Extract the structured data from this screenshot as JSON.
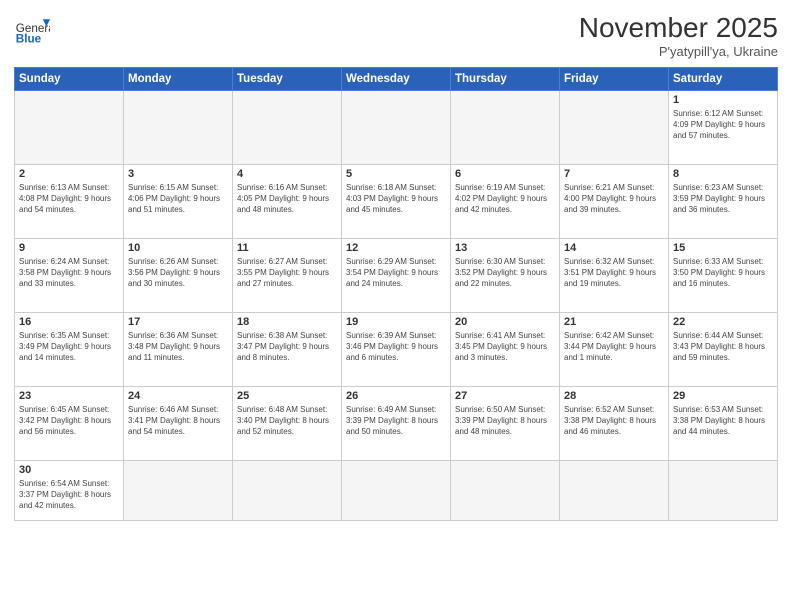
{
  "logo": {
    "text_general": "General",
    "text_blue": "Blue"
  },
  "title": "November 2025",
  "subtitle": "P'yatypill'ya, Ukraine",
  "days_of_week": [
    "Sunday",
    "Monday",
    "Tuesday",
    "Wednesday",
    "Thursday",
    "Friday",
    "Saturday"
  ],
  "weeks": [
    [
      {
        "day": "",
        "info": ""
      },
      {
        "day": "",
        "info": ""
      },
      {
        "day": "",
        "info": ""
      },
      {
        "day": "",
        "info": ""
      },
      {
        "day": "",
        "info": ""
      },
      {
        "day": "",
        "info": ""
      },
      {
        "day": "1",
        "info": "Sunrise: 6:12 AM\nSunset: 4:09 PM\nDaylight: 9 hours\nand 57 minutes."
      }
    ],
    [
      {
        "day": "2",
        "info": "Sunrise: 6:13 AM\nSunset: 4:08 PM\nDaylight: 9 hours\nand 54 minutes."
      },
      {
        "day": "3",
        "info": "Sunrise: 6:15 AM\nSunset: 4:06 PM\nDaylight: 9 hours\nand 51 minutes."
      },
      {
        "day": "4",
        "info": "Sunrise: 6:16 AM\nSunset: 4:05 PM\nDaylight: 9 hours\nand 48 minutes."
      },
      {
        "day": "5",
        "info": "Sunrise: 6:18 AM\nSunset: 4:03 PM\nDaylight: 9 hours\nand 45 minutes."
      },
      {
        "day": "6",
        "info": "Sunrise: 6:19 AM\nSunset: 4:02 PM\nDaylight: 9 hours\nand 42 minutes."
      },
      {
        "day": "7",
        "info": "Sunrise: 6:21 AM\nSunset: 4:00 PM\nDaylight: 9 hours\nand 39 minutes."
      },
      {
        "day": "8",
        "info": "Sunrise: 6:23 AM\nSunset: 3:59 PM\nDaylight: 9 hours\nand 36 minutes."
      }
    ],
    [
      {
        "day": "9",
        "info": "Sunrise: 6:24 AM\nSunset: 3:58 PM\nDaylight: 9 hours\nand 33 minutes."
      },
      {
        "day": "10",
        "info": "Sunrise: 6:26 AM\nSunset: 3:56 PM\nDaylight: 9 hours\nand 30 minutes."
      },
      {
        "day": "11",
        "info": "Sunrise: 6:27 AM\nSunset: 3:55 PM\nDaylight: 9 hours\nand 27 minutes."
      },
      {
        "day": "12",
        "info": "Sunrise: 6:29 AM\nSunset: 3:54 PM\nDaylight: 9 hours\nand 24 minutes."
      },
      {
        "day": "13",
        "info": "Sunrise: 6:30 AM\nSunset: 3:52 PM\nDaylight: 9 hours\nand 22 minutes."
      },
      {
        "day": "14",
        "info": "Sunrise: 6:32 AM\nSunset: 3:51 PM\nDaylight: 9 hours\nand 19 minutes."
      },
      {
        "day": "15",
        "info": "Sunrise: 6:33 AM\nSunset: 3:50 PM\nDaylight: 9 hours\nand 16 minutes."
      }
    ],
    [
      {
        "day": "16",
        "info": "Sunrise: 6:35 AM\nSunset: 3:49 PM\nDaylight: 9 hours\nand 14 minutes."
      },
      {
        "day": "17",
        "info": "Sunrise: 6:36 AM\nSunset: 3:48 PM\nDaylight: 9 hours\nand 11 minutes."
      },
      {
        "day": "18",
        "info": "Sunrise: 6:38 AM\nSunset: 3:47 PM\nDaylight: 9 hours\nand 8 minutes."
      },
      {
        "day": "19",
        "info": "Sunrise: 6:39 AM\nSunset: 3:46 PM\nDaylight: 9 hours\nand 6 minutes."
      },
      {
        "day": "20",
        "info": "Sunrise: 6:41 AM\nSunset: 3:45 PM\nDaylight: 9 hours\nand 3 minutes."
      },
      {
        "day": "21",
        "info": "Sunrise: 6:42 AM\nSunset: 3:44 PM\nDaylight: 9 hours\nand 1 minute."
      },
      {
        "day": "22",
        "info": "Sunrise: 6:44 AM\nSunset: 3:43 PM\nDaylight: 8 hours\nand 59 minutes."
      }
    ],
    [
      {
        "day": "23",
        "info": "Sunrise: 6:45 AM\nSunset: 3:42 PM\nDaylight: 8 hours\nand 56 minutes."
      },
      {
        "day": "24",
        "info": "Sunrise: 6:46 AM\nSunset: 3:41 PM\nDaylight: 8 hours\nand 54 minutes."
      },
      {
        "day": "25",
        "info": "Sunrise: 6:48 AM\nSunset: 3:40 PM\nDaylight: 8 hours\nand 52 minutes."
      },
      {
        "day": "26",
        "info": "Sunrise: 6:49 AM\nSunset: 3:39 PM\nDaylight: 8 hours\nand 50 minutes."
      },
      {
        "day": "27",
        "info": "Sunrise: 6:50 AM\nSunset: 3:39 PM\nDaylight: 8 hours\nand 48 minutes."
      },
      {
        "day": "28",
        "info": "Sunrise: 6:52 AM\nSunset: 3:38 PM\nDaylight: 8 hours\nand 46 minutes."
      },
      {
        "day": "29",
        "info": "Sunrise: 6:53 AM\nSunset: 3:38 PM\nDaylight: 8 hours\nand 44 minutes."
      }
    ],
    [
      {
        "day": "30",
        "info": "Sunrise: 6:54 AM\nSunset: 3:37 PM\nDaylight: 8 hours\nand 42 minutes."
      },
      {
        "day": "",
        "info": ""
      },
      {
        "day": "",
        "info": ""
      },
      {
        "day": "",
        "info": ""
      },
      {
        "day": "",
        "info": ""
      },
      {
        "day": "",
        "info": ""
      },
      {
        "day": "",
        "info": ""
      }
    ]
  ]
}
